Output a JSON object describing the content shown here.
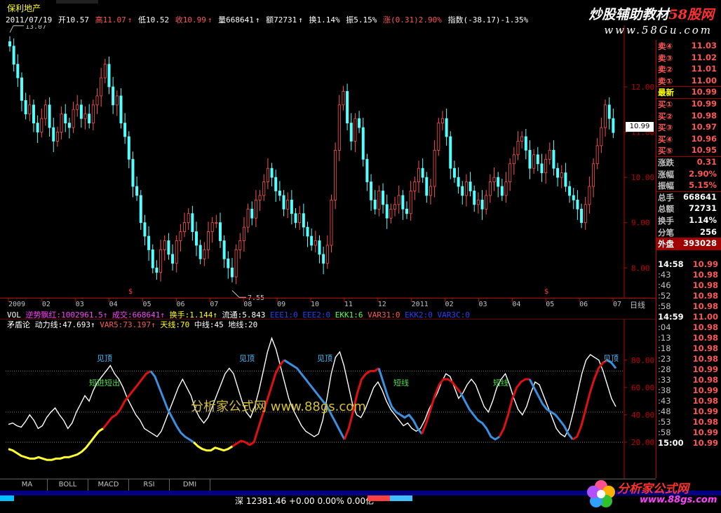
{
  "window": {
    "stock_name": "保利地产",
    "date": "2011/07/19",
    "open": "开10.57",
    "high": "高11.07",
    "low": "低10.52",
    "close": "收10.99",
    "volume": "量668641",
    "amount": "额72731",
    "turnover": "换1.14%",
    "amplitude": "振5.15%",
    "change": "涨(0.31)2.90%",
    "index_change": "指数(-38.17)-1.35%"
  },
  "branding": {
    "main_text": "炒股辅助教材",
    "main_red": "58股网",
    "url": "www.58Gu.com",
    "watermark": "分析家公式网 www.88gs.com",
    "fxj_text": "分析家公式网",
    "fxj_url": "www.88gs.com"
  },
  "colors": {
    "bull": "#ff5050",
    "bear": "#54ffff",
    "axis": "#c00000",
    "osc_white": "#ffffff",
    "osc_red": "#e01010",
    "osc_blue": "#3a90e0",
    "osc_yellow": "#ffff30"
  },
  "chart_data": [
    {
      "type": "candlestick",
      "title": "保利地产",
      "period": "日线",
      "y_ticks": [
        "8.00",
        "9.00",
        "10.00",
        "11.00",
        "12.00"
      ],
      "ylim": [
        7.4,
        13.3
      ],
      "x_labels": [
        "2009",
        "02",
        "03",
        "04",
        "05",
        "06",
        "07",
        "08",
        "09",
        "10",
        "11",
        "12",
        "2011",
        "02",
        "03",
        "04",
        "05",
        "06",
        "07"
      ],
      "annotations": {
        "max": "13.07",
        "min": "7.55",
        "current_tag": "10.99"
      },
      "closes": [
        12.9,
        12.5,
        12.2,
        11.7,
        11.4,
        11.6,
        11.2,
        11.0,
        11.3,
        11.6,
        11.1,
        10.8,
        11.0,
        11.4,
        11.2,
        11.1,
        11.5,
        11.6,
        11.3,
        11.4,
        11.2,
        11.6,
        11.8,
        12.2,
        12.5,
        12.0,
        11.6,
        11.8,
        11.2,
        10.9,
        10.4,
        9.8,
        9.6,
        9.0,
        8.7,
        8.4,
        8.0,
        7.9,
        8.4,
        8.6,
        8.3,
        8.1,
        8.6,
        8.8,
        9.0,
        9.2,
        8.8,
        8.5,
        8.2,
        8.4,
        8.8,
        9.0,
        9.0,
        8.6,
        8.2,
        8.0,
        7.8,
        8.4,
        8.6,
        8.9,
        9.3,
        9.1,
        9.5,
        9.6,
        9.9,
        10.2,
        10.0,
        9.7,
        9.6,
        9.3,
        9.5,
        9.2,
        9.0,
        9.2,
        8.9,
        8.7,
        8.5,
        8.6,
        8.3,
        8.1,
        8.5,
        9.5,
        10.6,
        11.6,
        11.9,
        11.2,
        10.8,
        11.3,
        11.1,
        10.4,
        9.9,
        9.5,
        9.3,
        9.7,
        9.4,
        9.1,
        9.3,
        9.4,
        9.6,
        9.3,
        9.2,
        9.7,
        9.9,
        10.2,
        10.0,
        9.6,
        9.8,
        10.6,
        11.2,
        11.3,
        10.9,
        10.2,
        10.0,
        9.8,
        9.6,
        9.9,
        9.7,
        9.4,
        9.5,
        9.3,
        9.6,
        9.9,
        10.0,
        9.8,
        9.6,
        9.9,
        10.3,
        10.5,
        10.8,
        10.9,
        10.6,
        10.2,
        10.5,
        10.3,
        10.1,
        10.4,
        10.6,
        10.2,
        10.0,
        10.1,
        9.8,
        9.6,
        9.5,
        9.3,
        9.0,
        9.4,
        9.8,
        10.3,
        10.7,
        11.1,
        11.6,
        11.3,
        10.99
      ],
      "series": [
        {
          "name": "VOL",
          "label": "VOL"
        },
        {
          "name": "逆势飘红",
          "label": "逆势飘红:1002961.5"
        },
        {
          "name": "成交",
          "label": "成交:668641"
        },
        {
          "name": "换手",
          "label": "换手:1.144"
        },
        {
          "name": "流通",
          "label": "流通:5.843"
        },
        {
          "name": "EEE1",
          "label": "EEE1:0"
        },
        {
          "name": "EEE2",
          "label": "EEE2:0"
        },
        {
          "name": "EKK1",
          "label": "EKK1:6"
        },
        {
          "name": "VAR31",
          "label": "VAR31:0"
        },
        {
          "name": "EKK2",
          "label": "EKK2:0"
        },
        {
          "name": "VAR3C",
          "label": "VAR3C:0"
        }
      ]
    },
    {
      "type": "line",
      "title": "矛盾论",
      "y_ticks": [
        "20.00",
        "40.00",
        "60.00",
        "80.00"
      ],
      "ylim": [
        0,
        105
      ],
      "ref_lines": [
        20,
        42,
        72
      ],
      "labels": [
        "动力线:47.693",
        "VAR5:73.197",
        "天线:70",
        "中线:45",
        "地线:20"
      ],
      "annotations": [
        "见顶",
        "见顶",
        "见顶",
        "见顶",
        "短进短出",
        "短线",
        "短线"
      ],
      "white": [
        33,
        34,
        32,
        31,
        35,
        40,
        36,
        30,
        32,
        38,
        42,
        45,
        40,
        36,
        30,
        34,
        42,
        48,
        54,
        50,
        58,
        64,
        68,
        72,
        76,
        70,
        66,
        60,
        52,
        46,
        40,
        36,
        30,
        28,
        26,
        24,
        28,
        36,
        44,
        52,
        60,
        66,
        60,
        54,
        44,
        38,
        34,
        38,
        46,
        54,
        62,
        70,
        74,
        70,
        60,
        50,
        42,
        38,
        46,
        58,
        72,
        86,
        96,
        88,
        76,
        64,
        52,
        44,
        38,
        32,
        28,
        26,
        24,
        26,
        36,
        52,
        70,
        82,
        86,
        76,
        62,
        48,
        40,
        38,
        44,
        52,
        60,
        64,
        58,
        50,
        44,
        40,
        36,
        32,
        34,
        30,
        28,
        30,
        36,
        44,
        50,
        56,
        64,
        70,
        68,
        60,
        52,
        56,
        62,
        66,
        62,
        54,
        46,
        42,
        50,
        60,
        66,
        70,
        62,
        52,
        44,
        40,
        46,
        56,
        64,
        62,
        54,
        46,
        38,
        30,
        26,
        24,
        30,
        42,
        56,
        70,
        80,
        84,
        82,
        80,
        72,
        62,
        52,
        46
      ],
      "pinned": [
        0,
        20,
        42,
        72
      ],
      "segments": [
        {
          "color": "osc_yellow",
          "from": 0,
          "to": 22,
          "values": [
            15,
            14,
            12,
            10,
            9,
            8,
            8,
            9,
            8,
            7,
            7,
            8,
            8,
            9,
            9,
            10,
            11,
            13,
            16,
            20,
            24,
            28,
            30
          ]
        },
        {
          "color": "osc_red",
          "from": 22,
          "to": 33,
          "values": [
            30,
            34,
            38,
            40,
            44,
            50,
            54,
            58,
            62,
            66,
            70,
            72
          ]
        },
        {
          "color": "osc_blue",
          "from": 33,
          "to": 43,
          "values": [
            72,
            68,
            60,
            52,
            44,
            38,
            32,
            27,
            24,
            22,
            20
          ]
        },
        {
          "color": "osc_yellow",
          "from": 43,
          "to": 52,
          "values": [
            20,
            17,
            15,
            14,
            14,
            16,
            15,
            14,
            15,
            17
          ]
        },
        {
          "color": "osc_red",
          "from": 52,
          "to": 64,
          "values": [
            17,
            19,
            21,
            20,
            18,
            20,
            30,
            40,
            50,
            60,
            70,
            76,
            80
          ]
        },
        {
          "color": "osc_blue",
          "from": 64,
          "to": 78,
          "values": [
            80,
            78,
            76,
            74,
            70,
            66,
            62,
            58,
            54,
            50,
            46,
            40,
            34,
            28,
            22
          ]
        },
        {
          "color": "osc_red",
          "from": 78,
          "to": 86,
          "values": [
            22,
            30,
            42,
            56,
            66,
            70,
            72,
            72,
            74
          ]
        },
        {
          "color": "osc_blue",
          "from": 86,
          "to": 96,
          "values": [
            74,
            64,
            54,
            46,
            42,
            40,
            38,
            40,
            36,
            30,
            26
          ]
        },
        {
          "color": "osc_red",
          "from": 96,
          "to": 105,
          "values": [
            26,
            34,
            44,
            54,
            62,
            66,
            66,
            64,
            60,
            56
          ]
        },
        {
          "color": "osc_blue",
          "from": 105,
          "to": 114,
          "values": [
            56,
            50,
            44,
            40,
            36,
            34,
            30,
            24,
            22,
            24
          ]
        },
        {
          "color": "osc_red",
          "from": 114,
          "to": 121,
          "values": [
            24,
            30,
            40,
            52,
            60,
            64,
            66,
            66
          ]
        },
        {
          "color": "osc_blue",
          "from": 121,
          "to": 131,
          "values": [
            66,
            60,
            54,
            48,
            44,
            42,
            40,
            36,
            32,
            26,
            22
          ]
        },
        {
          "color": "osc_red",
          "from": 131,
          "to": 139,
          "values": [
            22,
            24,
            32,
            44,
            56,
            66,
            74,
            78,
            80
          ]
        },
        {
          "color": "osc_blue",
          "from": 139,
          "to": 141,
          "values": [
            80,
            78,
            74
          ]
        }
      ]
    }
  ],
  "quote_panel": {
    "orders": [
      {
        "label": "卖④",
        "value": "11.03"
      },
      {
        "label": "卖③",
        "value": "11.02"
      },
      {
        "label": "卖②",
        "value": "11.01"
      },
      {
        "label": "卖①",
        "value": "11.00"
      },
      {
        "label": "最新",
        "value": "10.99"
      },
      {
        "label": "买①",
        "value": "10.99"
      },
      {
        "label": "买②",
        "value": "10.98"
      },
      {
        "label": "买③",
        "value": "10.97"
      },
      {
        "label": "买④",
        "value": "10.96"
      },
      {
        "label": "买⑤",
        "value": "10.95"
      },
      {
        "label": "涨跌",
        "value": "0.31"
      },
      {
        "label": "涨幅",
        "value": "2.90%"
      },
      {
        "label": "振幅",
        "value": "5.15%"
      },
      {
        "label": "总手",
        "value": "668641"
      },
      {
        "label": "总额",
        "value": "72731"
      },
      {
        "label": "换手",
        "value": "1.14%"
      },
      {
        "label": "分笔",
        "value": "256"
      },
      {
        "label": "外盘",
        "value": "393028"
      }
    ],
    "ticks": [
      {
        "time": "14:58",
        "price": "10.99"
      },
      {
        "time": ":43",
        "price": "10.98"
      },
      {
        "time": ":46",
        "price": "10.98"
      },
      {
        "time": ":52",
        "price": "10.98"
      },
      {
        "time": ":58",
        "price": "10.98"
      },
      {
        "time": "14:59",
        "price": "11.00"
      },
      {
        "time": ":04",
        "price": "10.98"
      },
      {
        "time": ":13",
        "price": "10.98"
      },
      {
        "time": ":18",
        "price": "10.98"
      },
      {
        "time": ":23",
        "price": "10.98"
      },
      {
        "time": ":28",
        "price": "10.99"
      },
      {
        "time": ":33",
        "price": "10.98"
      },
      {
        "time": ":38",
        "price": "10.99"
      },
      {
        "time": ":43",
        "price": "10.98"
      },
      {
        "time": ":48",
        "price": "10.99"
      },
      {
        "time": ":53",
        "price": "10.98"
      },
      {
        "time": ":58",
        "price": "10.99"
      },
      {
        "time": "15:00",
        "price": "10.99"
      }
    ]
  },
  "tabs": [
    "MA",
    "BOLL",
    "MACD",
    "RSI",
    "DMI"
  ],
  "status": {
    "market": "深",
    "index_text": "12381.46 +0.00 0.00% 0.00亿"
  }
}
